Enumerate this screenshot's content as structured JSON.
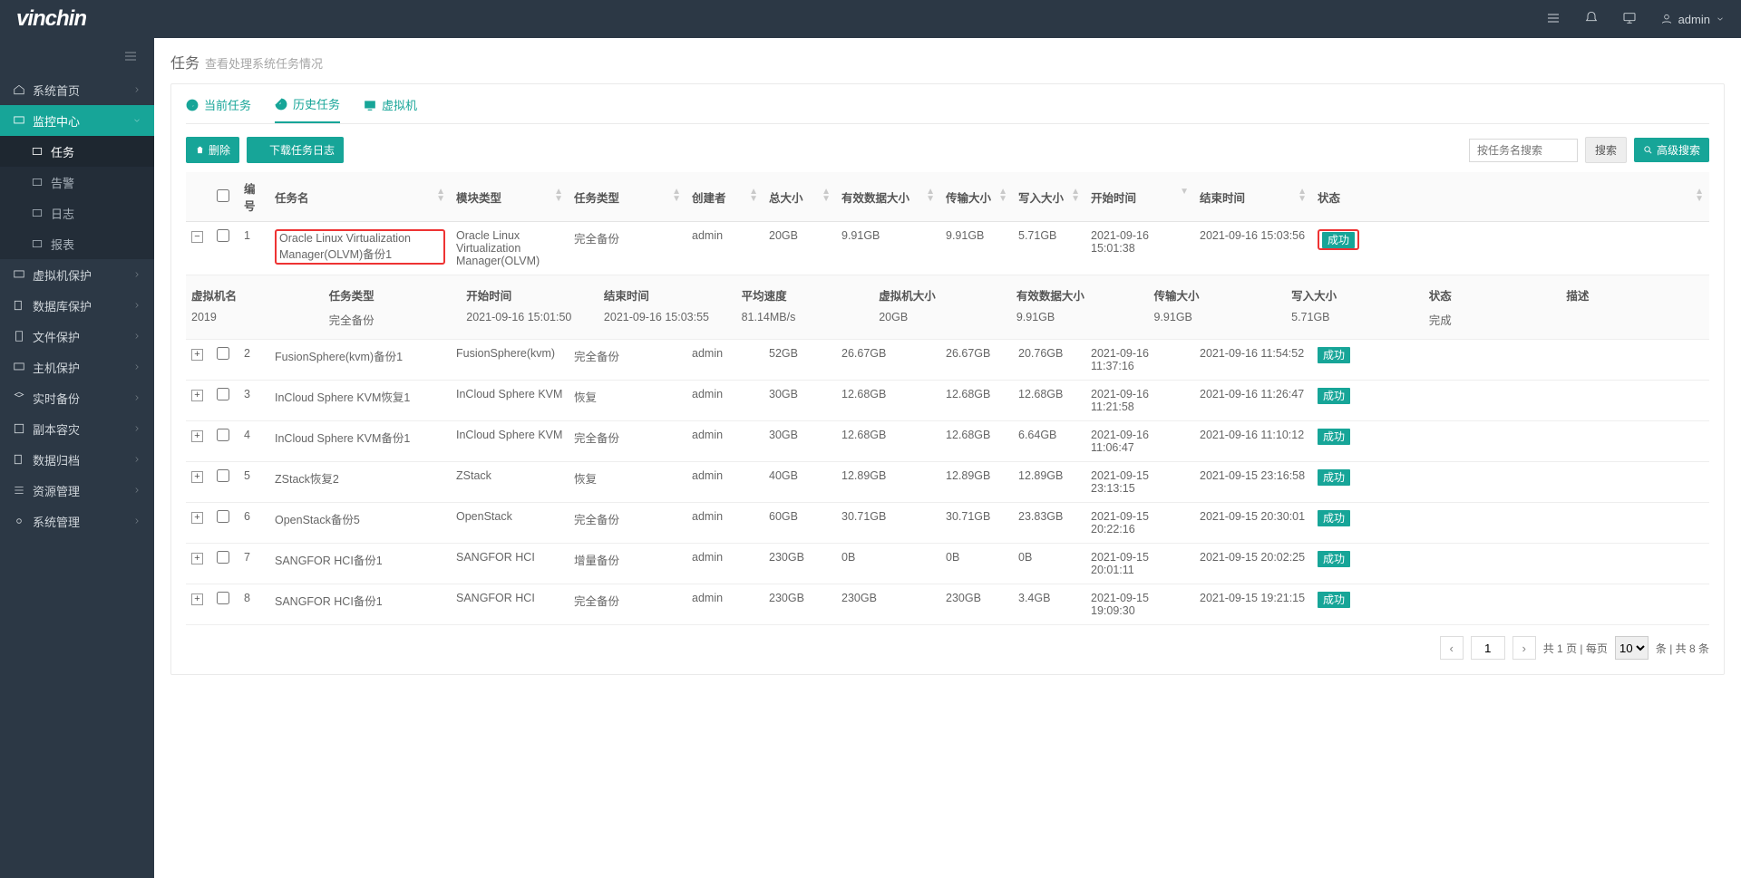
{
  "brand": "vinchin",
  "user": "admin",
  "sidebar": {
    "items": [
      {
        "label": "系统首页"
      },
      {
        "label": "监控中心",
        "active": true,
        "subs": [
          {
            "label": "任务",
            "sel": true
          },
          {
            "label": "告警"
          },
          {
            "label": "日志"
          },
          {
            "label": "报表"
          }
        ]
      },
      {
        "label": "虚拟机保护"
      },
      {
        "label": "数据库保护"
      },
      {
        "label": "文件保护"
      },
      {
        "label": "主机保护"
      },
      {
        "label": "实时备份"
      },
      {
        "label": "副本容灾"
      },
      {
        "label": "数据归档"
      },
      {
        "label": "资源管理"
      },
      {
        "label": "系统管理"
      }
    ]
  },
  "page": {
    "title": "任务",
    "subtitle": "查看处理系统任务情况"
  },
  "tabs": [
    {
      "label": "当前任务"
    },
    {
      "label": "历史任务",
      "active": true
    },
    {
      "label": "虚拟机"
    }
  ],
  "toolbar": {
    "delete": "删除",
    "download": "下载任务日志",
    "search_ph": "按任务名搜索",
    "search_btn": "搜索",
    "adv": "高级搜索"
  },
  "columns": {
    "idx": "编号",
    "name": "任务名",
    "module": "模块类型",
    "type": "任务类型",
    "creator": "创建者",
    "total": "总大小",
    "valid": "有效数据大小",
    "trans": "传输大小",
    "write": "写入大小",
    "start": "开始时间",
    "end": "结束时间",
    "status": "状态"
  },
  "rows": [
    {
      "idx": 1,
      "name": "Oracle Linux Virtualization Manager(OLVM)备份1",
      "module": "Oracle Linux Virtualization Manager(OLVM)",
      "type": "完全备份",
      "creator": "admin",
      "total": "20GB",
      "valid": "9.91GB",
      "trans": "9.91GB",
      "write": "5.71GB",
      "start": "2021-09-16 15:01:38",
      "end": "2021-09-16 15:03:56",
      "status": "成功",
      "hl": true,
      "expanded": true,
      "detail": {
        "vm": "2019",
        "type": "完全备份",
        "start": "2021-09-16 15:01:50",
        "end": "2021-09-16 15:03:55",
        "speed": "81.14MB/s",
        "size": "20GB",
        "valid": "9.91GB",
        "trans": "9.91GB",
        "write": "5.71GB",
        "state": "完成",
        "desc": ""
      }
    },
    {
      "idx": 2,
      "name": "FusionSphere(kvm)备份1",
      "module": "FusionSphere(kvm)",
      "type": "完全备份",
      "creator": "admin",
      "total": "52GB",
      "valid": "26.67GB",
      "trans": "26.67GB",
      "write": "20.76GB",
      "start": "2021-09-16 11:37:16",
      "end": "2021-09-16 11:54:52",
      "status": "成功"
    },
    {
      "idx": 3,
      "name": "InCloud Sphere KVM恢复1",
      "module": "InCloud Sphere KVM",
      "type": "恢复",
      "creator": "admin",
      "total": "30GB",
      "valid": "12.68GB",
      "trans": "12.68GB",
      "write": "12.68GB",
      "start": "2021-09-16 11:21:58",
      "end": "2021-09-16 11:26:47",
      "status": "成功"
    },
    {
      "idx": 4,
      "name": "InCloud Sphere KVM备份1",
      "module": "InCloud Sphere KVM",
      "type": "完全备份",
      "creator": "admin",
      "total": "30GB",
      "valid": "12.68GB",
      "trans": "12.68GB",
      "write": "6.64GB",
      "start": "2021-09-16 11:06:47",
      "end": "2021-09-16 11:10:12",
      "status": "成功"
    },
    {
      "idx": 5,
      "name": "ZStack恢复2",
      "module": "ZStack",
      "type": "恢复",
      "creator": "admin",
      "total": "40GB",
      "valid": "12.89GB",
      "trans": "12.89GB",
      "write": "12.89GB",
      "start": "2021-09-15 23:13:15",
      "end": "2021-09-15 23:16:58",
      "status": "成功"
    },
    {
      "idx": 6,
      "name": "OpenStack备份5",
      "module": "OpenStack",
      "type": "完全备份",
      "creator": "admin",
      "total": "60GB",
      "valid": "30.71GB",
      "trans": "30.71GB",
      "write": "23.83GB",
      "start": "2021-09-15 20:22:16",
      "end": "2021-09-15 20:30:01",
      "status": "成功"
    },
    {
      "idx": 7,
      "name": "SANGFOR HCI备份1",
      "module": "SANGFOR HCI",
      "type": "增量备份",
      "creator": "admin",
      "total": "230GB",
      "valid": "0B",
      "trans": "0B",
      "write": "0B",
      "start": "2021-09-15 20:01:11",
      "end": "2021-09-15 20:02:25",
      "status": "成功"
    },
    {
      "idx": 8,
      "name": "SANGFOR HCI备份1",
      "module": "SANGFOR HCI",
      "type": "完全备份",
      "creator": "admin",
      "total": "230GB",
      "valid": "230GB",
      "trans": "230GB",
      "write": "3.4GB",
      "start": "2021-09-15 19:09:30",
      "end": "2021-09-15 19:21:15",
      "status": "成功"
    }
  ],
  "detail_headers": {
    "vm": "虚拟机名",
    "type": "任务类型",
    "start": "开始时间",
    "end": "结束时间",
    "speed": "平均速度",
    "size": "虚拟机大小",
    "valid": "有效数据大小",
    "trans": "传输大小",
    "write": "写入大小",
    "state": "状态",
    "desc": "描述"
  },
  "pager": {
    "page": "1",
    "pages_prefix": "共 ",
    "pages_suffix": " 页 | 每页",
    "per_page": "10",
    "tail": "条 | 共 8 条",
    "total_pages": "1"
  }
}
